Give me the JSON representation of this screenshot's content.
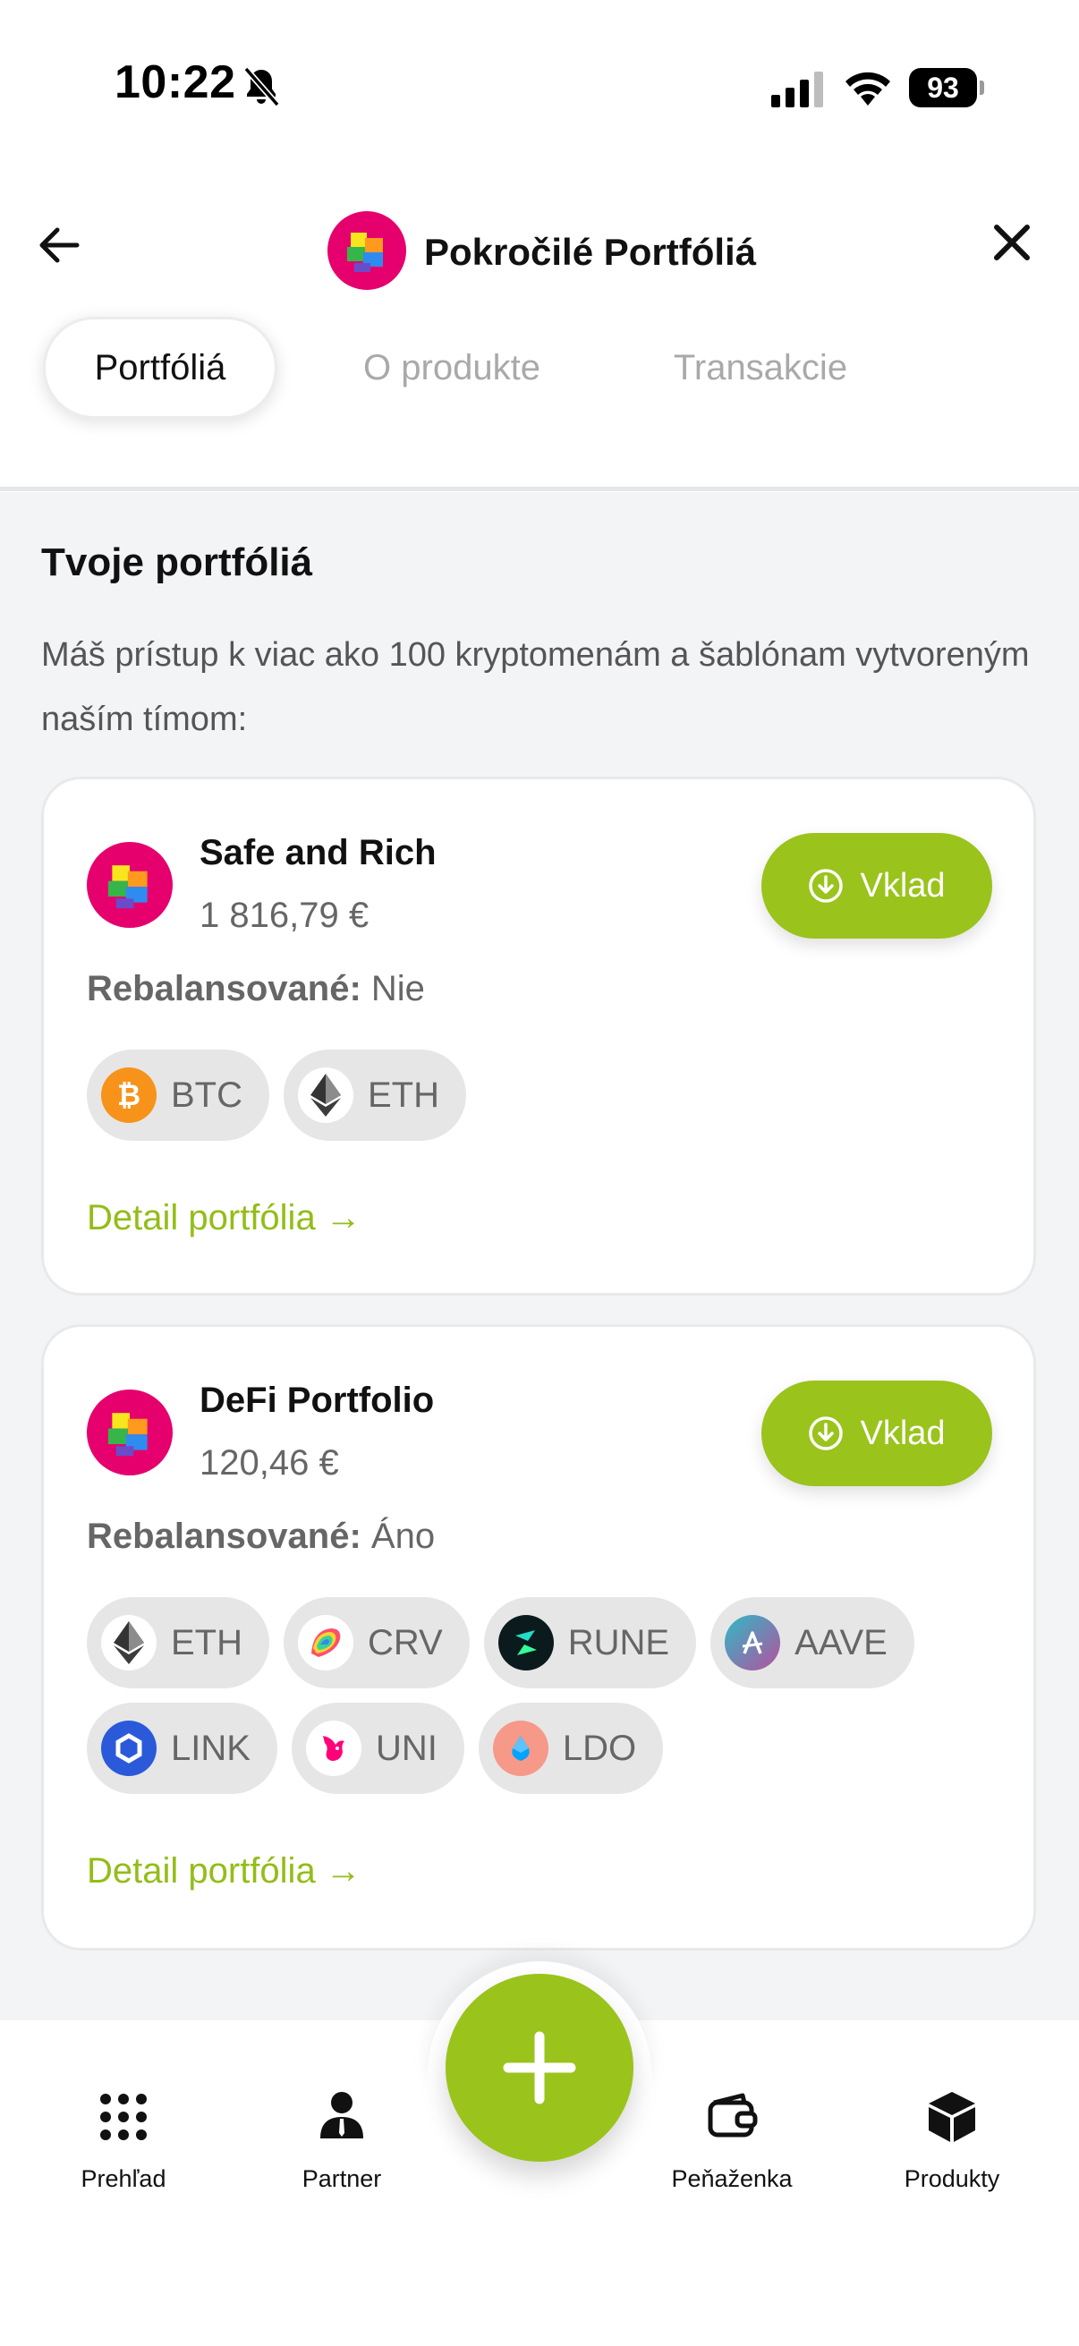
{
  "status_bar": {
    "time": "10:22",
    "battery": "93"
  },
  "header": {
    "title": "Pokročilé Portfóliá"
  },
  "tabs": [
    {
      "label": "Portfóliá",
      "active": true
    },
    {
      "label": "O produkte",
      "active": false
    },
    {
      "label": "Transakcie",
      "active": false
    }
  ],
  "section": {
    "title": "Tvoje portfóliá",
    "description": "Máš prístup k viac ako 100 kryptomenám a šablónam vytvoreným naším tímom:"
  },
  "portfolios": [
    {
      "name": "Safe and Rich",
      "value": "1 816,79 €",
      "rebalanced_label": "Rebalansované:",
      "rebalanced_value": "Nie",
      "deposit_label": "Vklad",
      "coins": [
        "BTC",
        "ETH"
      ],
      "detail_link": "Detail portfólia →"
    },
    {
      "name": "DeFi Portfolio",
      "value": "120,46 €",
      "rebalanced_label": "Rebalansované:",
      "rebalanced_value": "Áno",
      "deposit_label": "Vklad",
      "coins": [
        "ETH",
        "CRV",
        "RUNE",
        "AAVE",
        "LINK",
        "UNI",
        "LDO"
      ],
      "detail_link": "Detail portfólia →"
    }
  ],
  "bottom_nav": [
    {
      "label": "Prehľad",
      "icon": "grid-icon"
    },
    {
      "label": "Partner",
      "icon": "person-icon"
    },
    {
      "label": "",
      "icon": "plus-icon"
    },
    {
      "label": "Peňaženka",
      "icon": "wallet-icon"
    },
    {
      "label": "Produkty",
      "icon": "box-icon"
    }
  ],
  "colors": {
    "accent": "#9ac31c",
    "brand_pink": "#e5006e",
    "background": "#f3f4f6"
  }
}
